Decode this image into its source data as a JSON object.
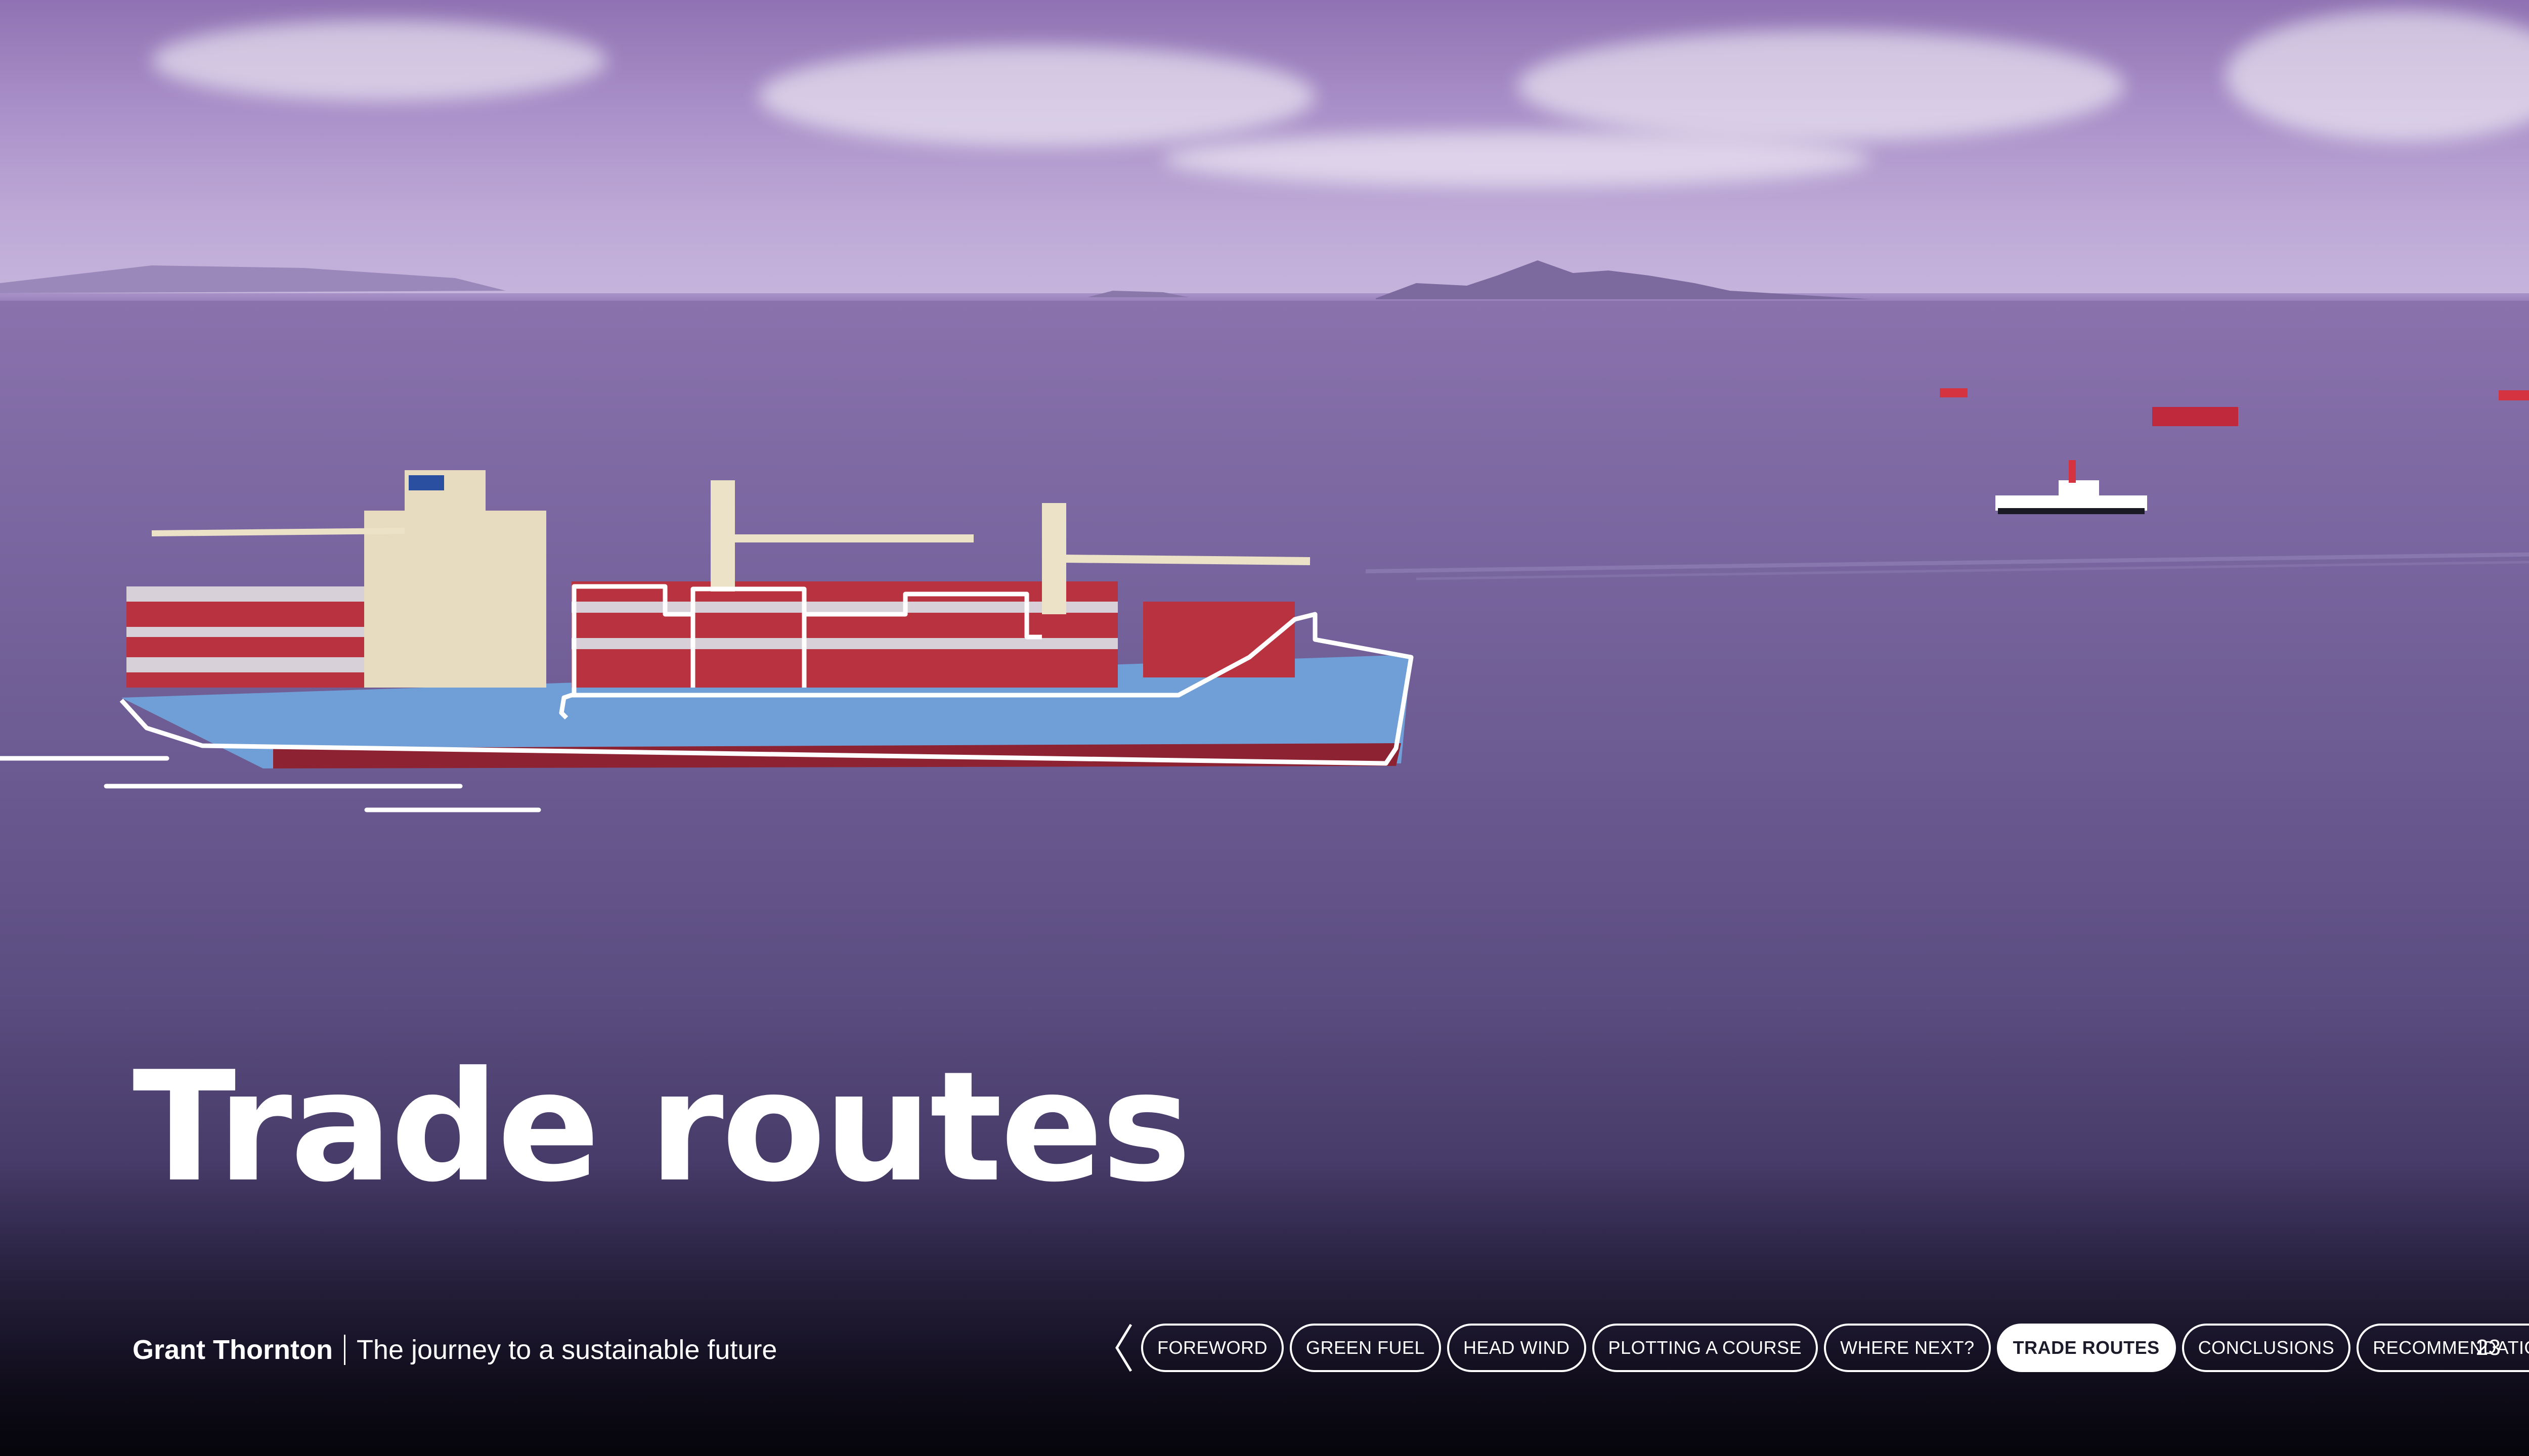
{
  "slide": {
    "title": "Trade routes",
    "footer": {
      "brand": "Grant Thornton",
      "subtitle": "The journey to a sustainable future"
    },
    "page_number": "23"
  },
  "nav": {
    "prev_icon": "chevron-left-icon",
    "next_icon": "chevron-right-icon",
    "items": [
      {
        "label": "FOREWORD"
      },
      {
        "label": "GREEN FUEL"
      },
      {
        "label": "HEAD WIND"
      },
      {
        "label": "PLOTTING A COURSE"
      },
      {
        "label": "WHERE NEXT?"
      },
      {
        "label": "TRADE ROUTES",
        "active": true
      },
      {
        "label": "CONCLUSIONS"
      },
      {
        "label": "RECOMMENDATIONS"
      }
    ]
  },
  "colors": {
    "sky": "#a98fc8",
    "sea": "#5b4d80",
    "hull": "#6f9fd6",
    "containers": "#b8323f",
    "text": "#ffffff"
  }
}
